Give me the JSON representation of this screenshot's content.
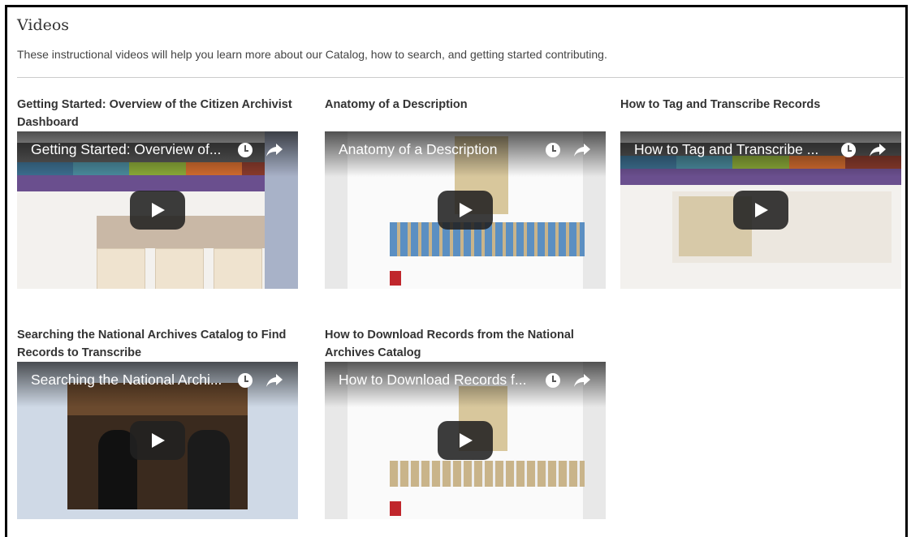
{
  "page": {
    "title": "Videos",
    "intro": "These instructional videos will help you learn more about our Catalog, how to search, and getting started contributing."
  },
  "videos": [
    {
      "heading": "Getting Started: Overview of the Citizen Archivist Dashboard",
      "player_title": "Getting Started: Overview of..."
    },
    {
      "heading": "Anatomy of a Description",
      "player_title": "Anatomy of a Description"
    },
    {
      "heading": "How to Tag and Transcribe Records",
      "player_title": "How to Tag and Transcribe ..."
    },
    {
      "heading": "Searching the National Archives Catalog to Find Records to Transcribe",
      "player_title": "Searching the National Archi..."
    },
    {
      "heading": "How to Download Records from the National Archives Catalog",
      "player_title": "How to Download Records f..."
    }
  ],
  "icons": {
    "watch_later": "clock-icon",
    "share": "share-arrow-icon",
    "play": "play-icon"
  },
  "colors": {
    "play_button": "#212121",
    "banner_purple": "#6a4f8e",
    "divider": "#cccccc"
  }
}
